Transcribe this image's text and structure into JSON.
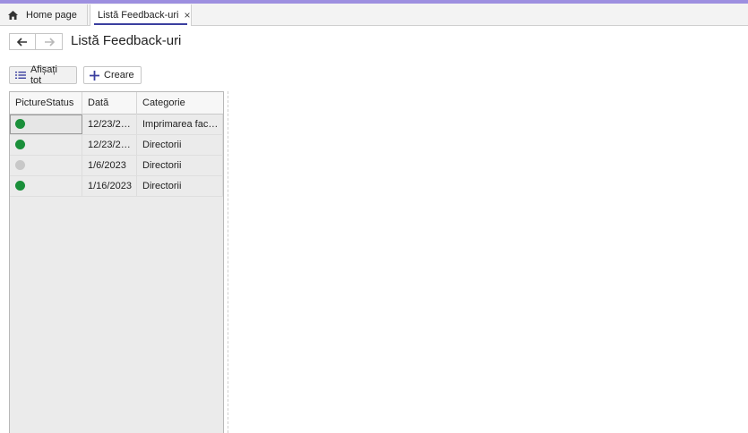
{
  "tabs": {
    "home_label": "Home page",
    "active_label": "Listă Feedback-uri",
    "close_glyph": "×"
  },
  "page": {
    "title": "Listă Feedback-uri"
  },
  "toolbar": {
    "show_all_label": "Afișați tot",
    "create_label": "Creare"
  },
  "grid": {
    "columns": [
      "PictureStatus",
      "Dată",
      "Categorie"
    ],
    "rows": [
      {
        "status_color": "#1a8f3a",
        "date": "12/23/2…",
        "category": "Imprimarea fac…"
      },
      {
        "status_color": "#1a8f3a",
        "date": "12/23/2…",
        "category": "Directorii"
      },
      {
        "status_color": "#c8c8c8",
        "date": "1/6/2023",
        "category": "Directorii"
      },
      {
        "status_color": "#1a8f3a",
        "date": "1/16/2023",
        "category": "Directorii"
      }
    ]
  },
  "colors": {
    "accent": "#3b3f9f",
    "status_ok": "#1a8f3a",
    "status_inactive": "#c8c8c8"
  },
  "icons": {
    "home": "home-icon",
    "back": "arrow-left-icon",
    "forward": "arrow-right-icon",
    "list": "list-icon",
    "add": "plus-icon"
  }
}
